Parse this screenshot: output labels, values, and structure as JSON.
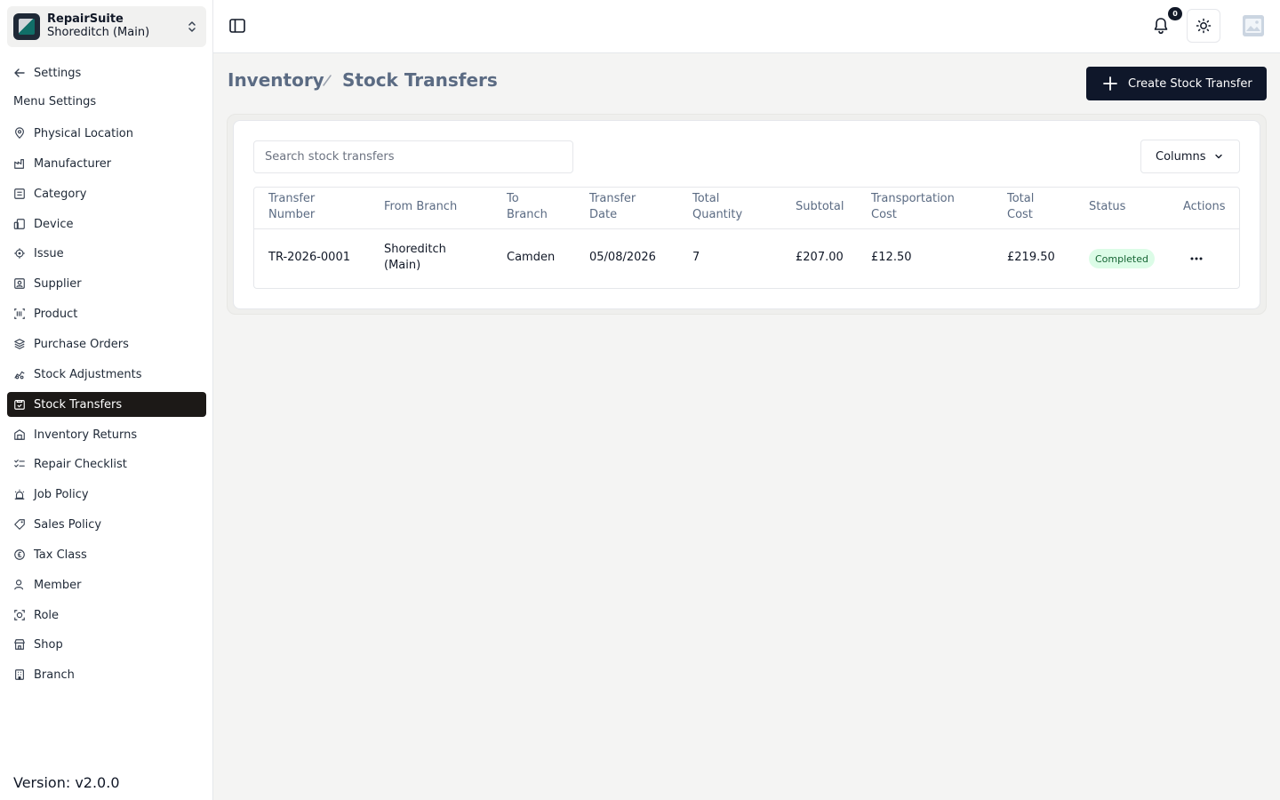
{
  "brand": {
    "name": "RepairSuite",
    "branch": "Shoreditch (Main)"
  },
  "sidebar": {
    "back_label": "Settings",
    "menu_heading": "Menu Settings",
    "items": [
      {
        "label": "Physical Location",
        "icon": "map-pin-icon"
      },
      {
        "label": "Manufacturer",
        "icon": "factory-icon"
      },
      {
        "label": "Category",
        "icon": "category-icon"
      },
      {
        "label": "Device",
        "icon": "devices-icon"
      },
      {
        "label": "Issue",
        "icon": "bug-icon"
      },
      {
        "label": "Supplier",
        "icon": "supplier-icon"
      },
      {
        "label": "Product",
        "icon": "barcode-icon"
      },
      {
        "label": "Purchase Orders",
        "icon": "layers-icon"
      },
      {
        "label": "Stock Adjustments",
        "icon": "adjust-icon"
      },
      {
        "label": "Stock Transfers",
        "icon": "transfer-icon",
        "active": true
      },
      {
        "label": "Inventory Returns",
        "icon": "return-icon"
      },
      {
        "label": "Repair Checklist",
        "icon": "checklist-icon"
      },
      {
        "label": "Job Policy",
        "icon": "siren-icon"
      },
      {
        "label": "Sales Policy",
        "icon": "tag-icon"
      },
      {
        "label": "Tax Class",
        "icon": "pound-icon"
      },
      {
        "label": "Member",
        "icon": "user-icon"
      },
      {
        "label": "Role",
        "icon": "role-icon"
      },
      {
        "label": "Shop",
        "icon": "store-icon"
      },
      {
        "label": "Branch",
        "icon": "building-icon"
      }
    ],
    "version": "Version: v2.0.0"
  },
  "topbar": {
    "notification_count": "0"
  },
  "breadcrumb": {
    "parent": "Inventory",
    "current": "Stock Transfers"
  },
  "actions": {
    "create_label": "Create Stock Transfer",
    "columns_label": "Columns"
  },
  "search": {
    "placeholder": "Search stock transfers",
    "value": ""
  },
  "table": {
    "headers": {
      "transfer_number": [
        "Transfer",
        "Number"
      ],
      "from_branch": "From Branch",
      "to_branch": [
        "To",
        "Branch"
      ],
      "transfer_date": [
        "Transfer",
        "Date"
      ],
      "total_quantity": [
        "Total",
        "Quantity"
      ],
      "subtotal": "Subtotal",
      "transportation_cost": [
        "Transportation",
        "Cost"
      ],
      "total_cost": [
        "Total",
        "Cost"
      ],
      "status": "Status",
      "actions": "Actions"
    },
    "rows": [
      {
        "transfer_number": "TR-2026-0001",
        "from_branch": [
          "Shoreditch",
          "(Main)"
        ],
        "to_branch": "Camden",
        "transfer_date": "05/08/2026",
        "total_quantity": "7",
        "subtotal": "£207.00",
        "transportation_cost": "£12.50",
        "total_cost": "£219.50",
        "status": "Completed",
        "status_color": "#166534"
      }
    ]
  },
  "colors": {
    "active_nav": "#1c1917",
    "primary_button": "#0f172a",
    "muted_text": "#5b6b83",
    "success_bg": "#dcfce7"
  }
}
